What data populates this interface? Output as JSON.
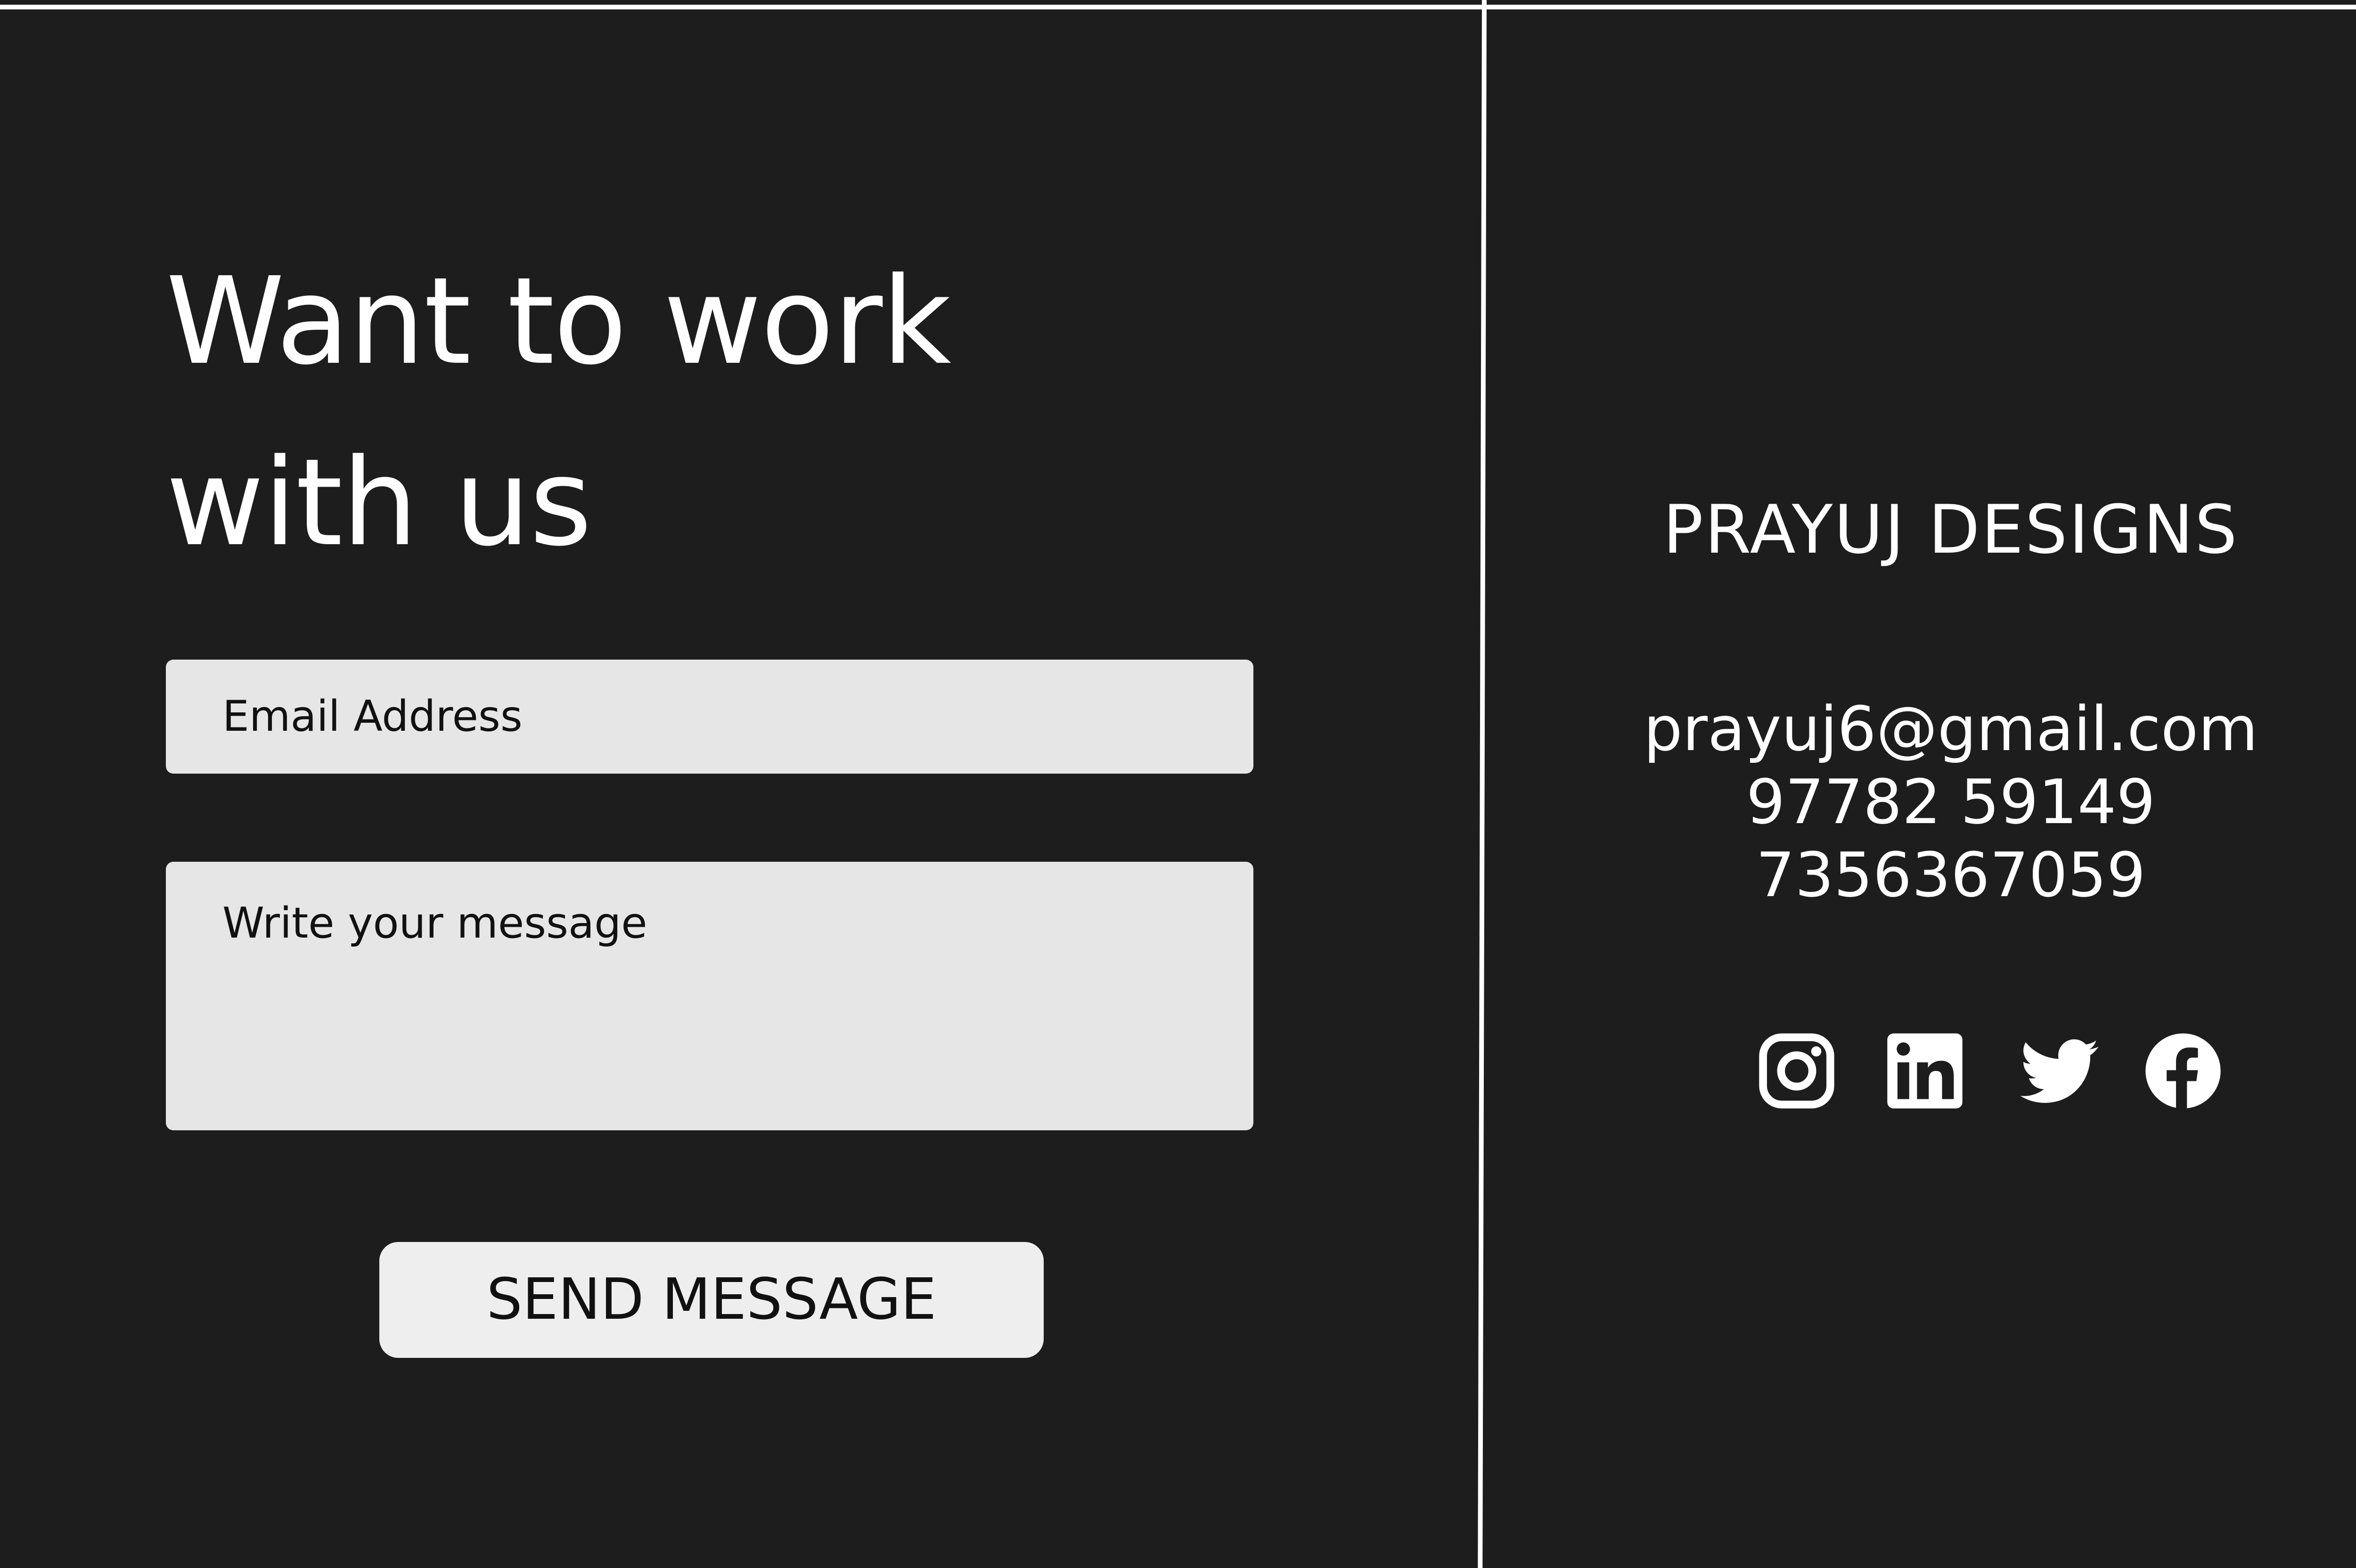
{
  "contact_form": {
    "heading_line1": "Want to work",
    "heading_line2": "with us",
    "email_placeholder": "Email Address",
    "message_placeholder": "Write your message",
    "submit_label": "SEND MESSAGE"
  },
  "company": {
    "name": "PRAYUJ DESIGNS",
    "email": "prayuj6@gmail.com",
    "phone_1": "97782 59149",
    "phone_2": "7356367059"
  },
  "social_links": [
    {
      "icon": "instagram-icon"
    },
    {
      "icon": "linkedin-icon"
    },
    {
      "icon": "twitter-icon"
    },
    {
      "icon": "facebook-icon"
    }
  ],
  "colors": {
    "background": "#1d1d1d",
    "foreground": "#ffffff",
    "field_background": "#e6e6e6",
    "button_background": "#eeeeee",
    "button_text": "#111111"
  }
}
